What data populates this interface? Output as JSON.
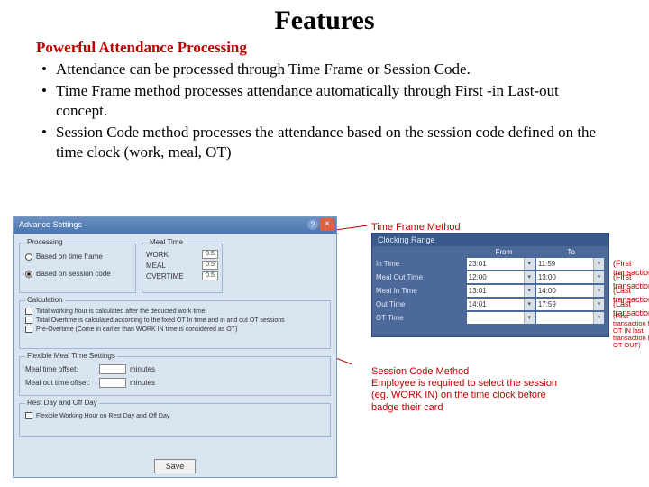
{
  "title": "Features",
  "subtitle": "Powerful Attendance Processing",
  "bullets": [
    "Attendance can be processed through Time Frame or Session Code.",
    "Time Frame method processes attendance automatically through First -in Last-out concept.",
    "Session Code method processes the attendance based on the session code defined on the time clock (work, meal, OT)"
  ],
  "dialog": {
    "title": "Advance Settings",
    "groups": {
      "processing": "Processing",
      "meal": "Meal Time",
      "calc": "Calculation",
      "flex": "Flexible Meal Time Settings",
      "rest": "Rest Day and Off Day"
    },
    "proc_opts": [
      "Based on time frame",
      "Based on session code"
    ],
    "meal_rows": [
      {
        "label": "WORK",
        "val": "0.5"
      },
      {
        "label": "MEAL",
        "val": "0.5"
      },
      {
        "label": "OVERTIME",
        "val": "0.5"
      }
    ],
    "calc_rows": [
      "Total working hour is calculated after the deducted work time",
      "Total Overtime is calculated according to the fixed OT In time and in and out OT sessions",
      "Pre-Overtime (Come in earlier than WORK IN time is considered as OT)"
    ],
    "flex_rows": [
      "Meal time offset:",
      "Meal out time offset:"
    ],
    "flex_unit": "minutes",
    "rest_row": "Flexible Working Hour on Rest Day and Off Day",
    "save": "Save"
  },
  "labels": {
    "tf": "Time Frame Method",
    "sc": "Session Code Method\nEmployee is required to select the session (eg. WORK IN) on the time clock before badge their card"
  },
  "panel": {
    "title": "Clocking Range",
    "head": [
      "From",
      "To"
    ],
    "rows": [
      {
        "label": "In Time",
        "from": "23:01",
        "to": "11:59"
      },
      {
        "label": "Meal Out Time",
        "from": "12:00",
        "to": "13:00"
      },
      {
        "label": "Meal In Time",
        "from": "13:01",
        "to": "14:00"
      },
      {
        "label": "Out Time",
        "from": "14:01",
        "to": "17:59"
      },
      {
        "label": "OT Time",
        "from": "",
        "to": ""
      }
    ]
  },
  "annots": {
    "a1": "(First transaction)",
    "a2": "(First transaction)",
    "a3": "(Last transaction)",
    "a4": "(Last transaction)",
    "a5": "(First transaction for OT IN last transaction For OT OUT)"
  }
}
